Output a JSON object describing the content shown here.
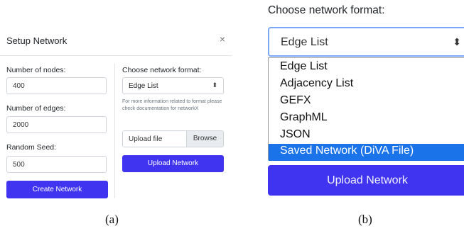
{
  "panel_a": {
    "title": "Setup Network",
    "close_symbol": "×",
    "nodes_label": "Number of nodes:",
    "nodes_value": "400",
    "edges_label": "Number of edges:",
    "edges_value": "2000",
    "seed_label": "Random Seed:",
    "seed_value": "500",
    "create_button": "Create Network",
    "format_label": "Choose network format:",
    "format_selected": "Edge List",
    "help_text": "For more information related to format please check documentation for networkX",
    "upload_placeholder": "Upload file",
    "browse_button": "Browse",
    "upload_button": "Upload Network"
  },
  "panel_b": {
    "format_label": "Choose network format:",
    "format_selected": "Edge List",
    "options": [
      "Edge List",
      "Adjacency List",
      "GEFX",
      "GraphML",
      "JSON",
      "Saved Network (DiVA File)"
    ],
    "highlighted_option": "Saved Network (DiVA File)",
    "upload_button": "Upload Network"
  },
  "captions": {
    "a": "(a)",
    "b": "(b)"
  },
  "colors": {
    "primary": "#4034f0",
    "highlight": "#1a73e8",
    "focus_border": "#7aa7f7"
  },
  "icons": {
    "close": "close-icon",
    "select_arrow": "chevron-up-down-icon"
  }
}
